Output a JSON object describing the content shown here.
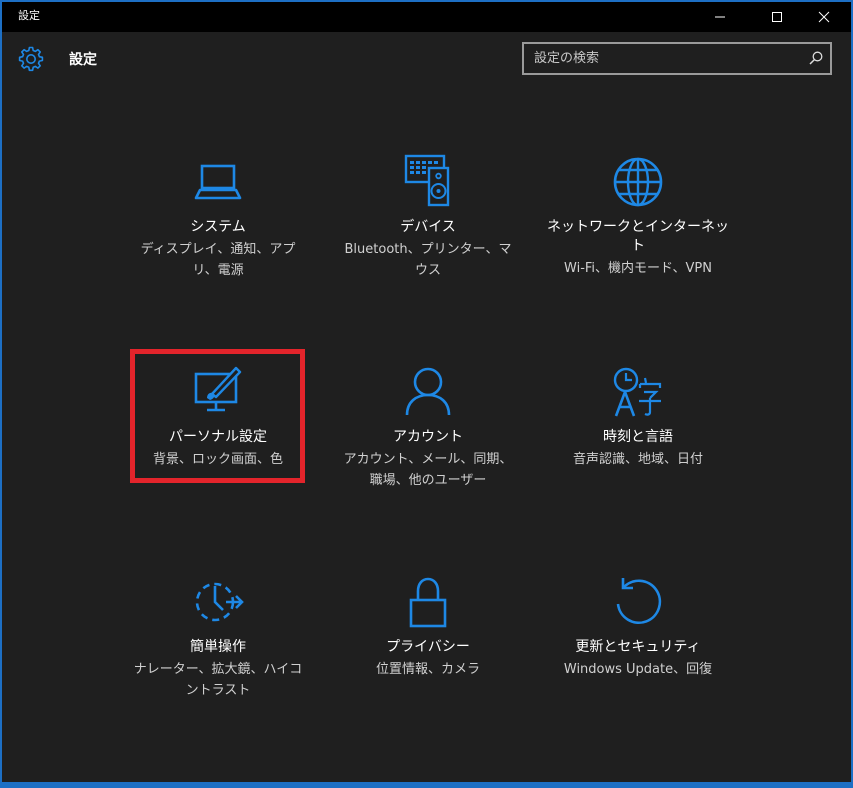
{
  "window": {
    "title": "設定",
    "caption_buttons": [
      "minimize",
      "maximize",
      "close"
    ]
  },
  "header": {
    "title": "設定",
    "search_placeholder": "設定の検索"
  },
  "colors": {
    "accent": "#1e88e5",
    "background": "#1f1f1f",
    "titlebar": "#000000",
    "highlight": "#e3242b"
  },
  "tiles": [
    {
      "title": "システム",
      "desc": "ディスプレイ、通知、アプリ、電源",
      "icon": "laptop-icon"
    },
    {
      "title": "デバイス",
      "desc": "Bluetooth、プリンター、マウス",
      "icon": "devices-icon"
    },
    {
      "title": "ネットワークとインターネット",
      "desc": "Wi-Fi、機内モード、VPN",
      "icon": "globe-icon"
    },
    {
      "title": "パーソナル設定",
      "desc": "背景、ロック画面、色",
      "icon": "personalization-icon",
      "highlighted": true
    },
    {
      "title": "アカウント",
      "desc": "アカウント、メール、同期、職場、他のユーザー",
      "icon": "person-icon"
    },
    {
      "title": "時刻と言語",
      "desc": "音声認識、地域、日付",
      "icon": "time-language-icon"
    },
    {
      "title": "簡単操作",
      "desc": "ナレーター、拡大鏡、ハイコントラスト",
      "icon": "ease-of-access-icon"
    },
    {
      "title": "プライバシー",
      "desc": "位置情報、カメラ",
      "icon": "lock-icon"
    },
    {
      "title": "更新とセキュリティ",
      "desc": "Windows Update、回復",
      "icon": "refresh-icon"
    }
  ]
}
